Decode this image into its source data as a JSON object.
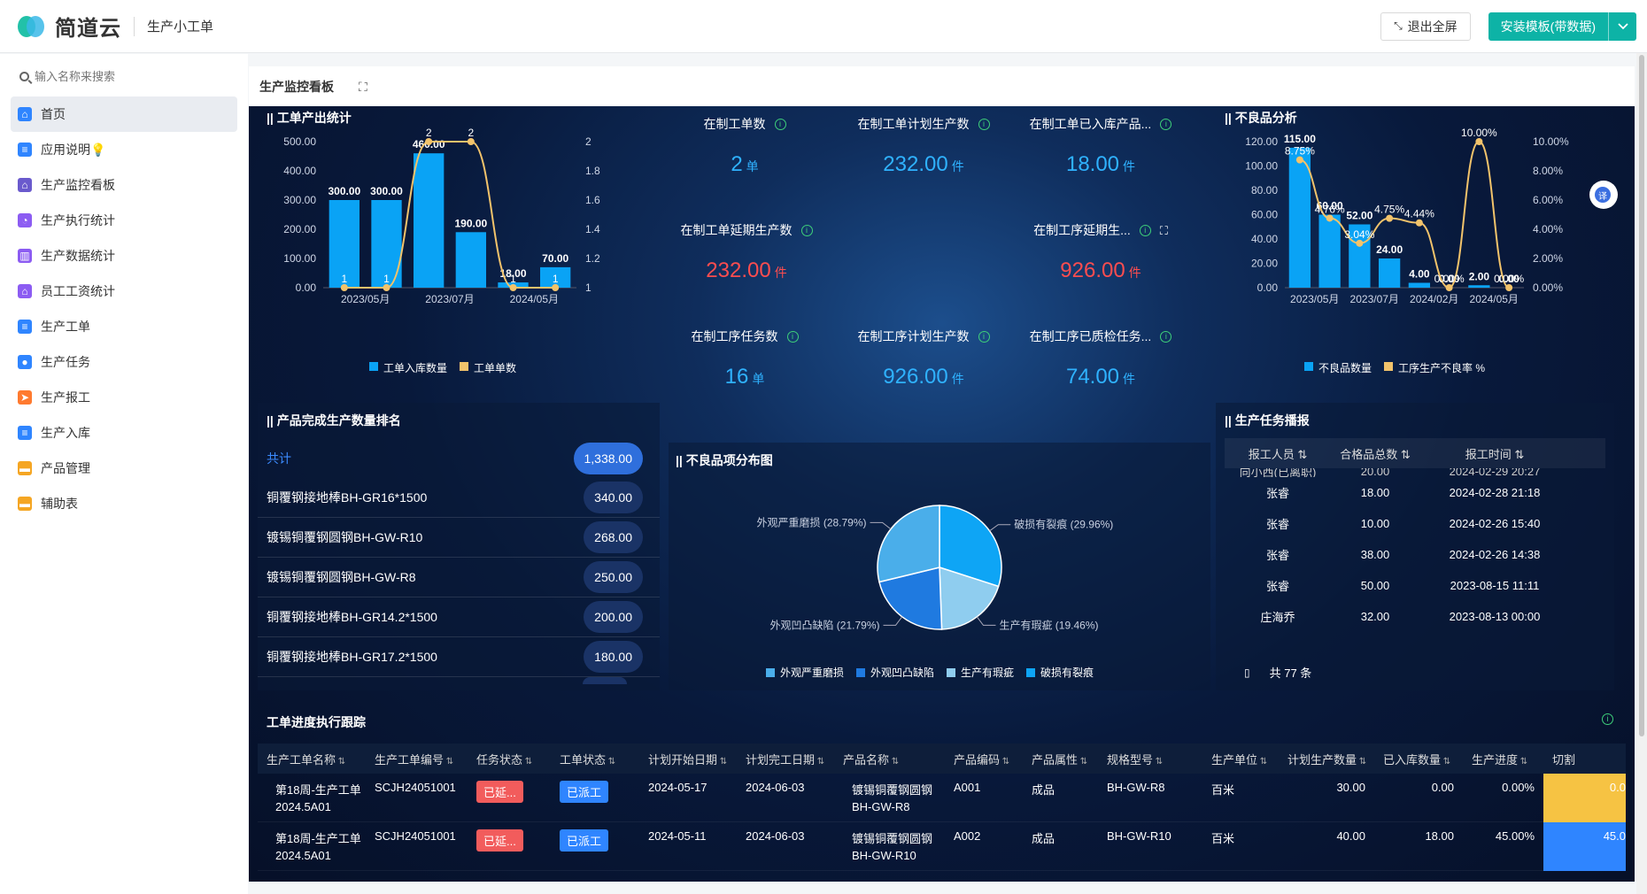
{
  "app": {
    "logo_text": "简道云",
    "title": "生产小工单",
    "exit_fullscreen": "退出全屏",
    "install_template": "安装模板(带数据)"
  },
  "sidebar": {
    "search_placeholder": "输入名称来搜索",
    "items": [
      {
        "label": "首页",
        "icon": "home-icon",
        "color": "#2f85ff"
      },
      {
        "label": "应用说明💡",
        "icon": "doc-icon",
        "color": "#2f85ff"
      },
      {
        "label": "生产监控看板",
        "icon": "home-icon",
        "color": "#6a5acd"
      },
      {
        "label": "生产执行统计",
        "icon": "chart-icon",
        "color": "#8c5cf2"
      },
      {
        "label": "生产数据统计",
        "icon": "bar-chart-icon",
        "color": "#8c5cf2"
      },
      {
        "label": "员工工资统计",
        "icon": "home-icon",
        "color": "#8c5cf2"
      },
      {
        "label": "生产工单",
        "icon": "doc-icon",
        "color": "#2f85ff"
      },
      {
        "label": "生产任务",
        "icon": "circle-icon",
        "color": "#2f85ff"
      },
      {
        "label": "生产报工",
        "icon": "send-icon",
        "color": "#ff7a2f"
      },
      {
        "label": "生产入库",
        "icon": "doc-icon",
        "color": "#2f85ff"
      },
      {
        "label": "产品管理",
        "icon": "folder-icon",
        "color": "#f5a623"
      },
      {
        "label": "辅助表",
        "icon": "folder-icon",
        "color": "#f5a623"
      }
    ]
  },
  "header": {
    "title": "生产监控看板"
  },
  "output_panel": {
    "title": "工单产出统计",
    "legend1": "工单入库数量",
    "legend2": "工单单数"
  },
  "kpis": [
    {
      "label": "在制工单数",
      "value": "2",
      "unit": "单",
      "color": "blue"
    },
    {
      "label": "在制工单计划生产数",
      "value": "232.00",
      "unit": "件",
      "color": "blue"
    },
    {
      "label": "在制工单已入库产品...",
      "value": "18.00",
      "unit": "件",
      "color": "blue"
    },
    {
      "label": "在制工单延期生产数",
      "value": "232.00",
      "unit": "件",
      "color": "red"
    },
    {
      "label": "在制工序延期生...",
      "value": "926.00",
      "unit": "件",
      "color": "red"
    },
    {
      "label": "在制工序任务数",
      "value": "16",
      "unit": "单",
      "color": "blue"
    },
    {
      "label": "在制工序计划生产数",
      "value": "926.00",
      "unit": "件",
      "color": "blue"
    },
    {
      "label": "在制工序已质检任务...",
      "value": "74.00",
      "unit": "件",
      "color": "blue"
    }
  ],
  "defect_panel": {
    "title": "不良品分析",
    "legend1": "不良品数量",
    "legend2": "工序生产不良率 %"
  },
  "ranking": {
    "title": "产品完成生产数量排名",
    "total_label": "共计",
    "total_value": "1,338.00",
    "rows": [
      {
        "name": "铜覆钢接地棒BH-GR16*1500",
        "value": "340.00"
      },
      {
        "name": "镀锡铜覆钢圆钢BH-GW-R10",
        "value": "268.00"
      },
      {
        "name": "镀锡铜覆钢圆钢BH-GW-R8",
        "value": "250.00"
      },
      {
        "name": "铜覆钢接地棒BH-GR14.2*1500",
        "value": "200.00"
      },
      {
        "name": "铜覆钢接地棒BH-GR17.2*1500",
        "value": "180.00"
      }
    ]
  },
  "pie_panel": {
    "title": "不良品项分布图"
  },
  "broadcast": {
    "title": "生产任务播报",
    "headers": [
      "报工人员",
      "合格品总数",
      "报工时间"
    ],
    "partial_row": [
      "向小西(已离职)",
      "20.00",
      "2024-02-29 20:27"
    ],
    "rows": [
      [
        "张睿",
        "18.00",
        "2024-02-28 21:18"
      ],
      [
        "张睿",
        "10.00",
        "2024-02-26 15:40"
      ],
      [
        "张睿",
        "38.00",
        "2024-02-26 14:38"
      ],
      [
        "张睿",
        "50.00",
        "2023-08-15 11:11"
      ],
      [
        "庄海乔",
        "32.00",
        "2023-08-13 00:00"
      ]
    ],
    "footer": "共 77 条"
  },
  "progress_table": {
    "title": "工单进度执行跟踪",
    "headers": [
      "生产工单名称",
      "生产工单编号",
      "任务状态",
      "工单状态",
      "计划开始日期",
      "计划完工日期",
      "产品名称",
      "产品编码",
      "产品属性",
      "规格型号",
      "生产单位",
      "计划生产数量",
      "已入库数量",
      "生产进度",
      "切割"
    ],
    "rows": [
      {
        "name": "第18周-生产工单",
        "name2": "2024.5A01",
        "code": "SCJH24051001",
        "task": "已延...",
        "status": "已派工",
        "start": "2024-05-17",
        "end": "2024-06-03",
        "product": "镀锡铜覆钢圆钢",
        "product2": "BH-GW-R8",
        "pcode": "A001",
        "attr": "成品",
        "spec": "BH-GW-R8",
        "unit": "百米",
        "plan": "30.00",
        "stored": "0.00",
        "progress": "0.00%",
        "cut": "0.0"
      },
      {
        "name": "第18周-生产工单",
        "name2": "2024.5A01",
        "code": "SCJH24051001",
        "task": "已延...",
        "status": "已派工",
        "start": "2024-05-11",
        "end": "2024-06-03",
        "product": "镀锡铜覆钢圆钢",
        "product2": "BH-GW-R10",
        "pcode": "A002",
        "attr": "成品",
        "spec": "BH-GW-R10",
        "unit": "百米",
        "plan": "40.00",
        "stored": "18.00",
        "progress": "45.00%",
        "cut": "45.0"
      }
    ]
  },
  "chart_data": [
    {
      "type": "bar",
      "title": "工单产出统计",
      "categories": [
        "2023/05月",
        "",
        "2023/07月",
        "",
        "2024/05月",
        ""
      ],
      "series": [
        {
          "name": "工单入库数量",
          "values": [
            300.0,
            300.0,
            460.0,
            190.0,
            18.0,
            70.0
          ]
        },
        {
          "name": "工单单数",
          "type": "line",
          "values": [
            1,
            1,
            2,
            2,
            1,
            1
          ]
        }
      ],
      "ylim": [
        0,
        500
      ],
      "y2lim": [
        1,
        2
      ],
      "xlabel": "",
      "ylabel": ""
    },
    {
      "type": "bar",
      "title": "不良品分析",
      "categories": [
        "2023/05月",
        "",
        "2023/07月",
        "",
        "2024/02月",
        "",
        "2024/05月",
        ""
      ],
      "series": [
        {
          "name": "不良品数量",
          "values": [
            115.0,
            60.0,
            52.0,
            24.0,
            4.0,
            0.0,
            2.0,
            0.0
          ]
        },
        {
          "name": "工序生产不良率 %",
          "type": "line",
          "values": [
            8.75,
            4.76,
            3.04,
            4.75,
            4.44,
            0.0,
            10.0,
            0.0
          ]
        }
      ],
      "ylim": [
        0,
        120
      ],
      "y2lim": [
        0,
        10
      ],
      "xlabel": "",
      "ylabel": ""
    },
    {
      "type": "pie",
      "title": "不良品项分布图",
      "slices": [
        {
          "label": "破损有裂痕",
          "value": 29.96,
          "color": "#0ea5f5"
        },
        {
          "label": "生产有瑕疵",
          "value": 19.46,
          "color": "#8fcdef"
        },
        {
          "label": "外观凹凸缺陷",
          "value": 21.79,
          "color": "#1f7ae0"
        },
        {
          "label": "外观严重磨损",
          "value": 28.79,
          "color": "#4aaeea"
        }
      ],
      "legend": [
        "外观严重磨损",
        "外观凹凸缺陷",
        "生产有瑕疵",
        "破损有裂痕"
      ]
    }
  ]
}
